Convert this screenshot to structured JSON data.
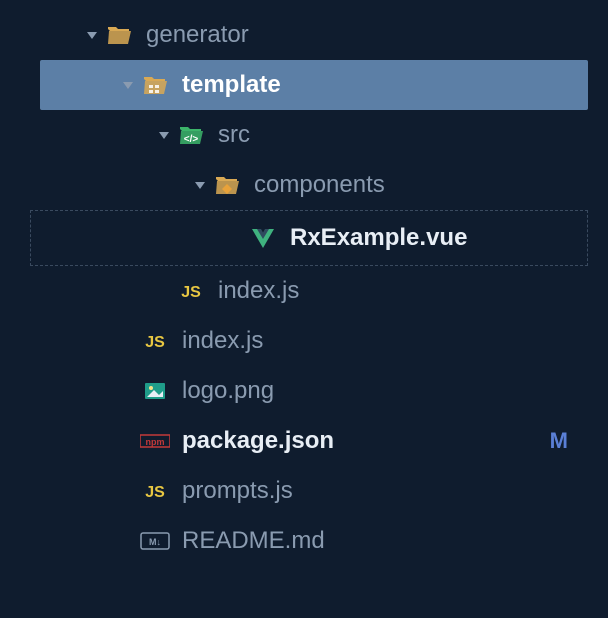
{
  "tree": {
    "items": [
      {
        "label": "generator",
        "icon": "folder-open",
        "depth": 0,
        "expanded": true,
        "selected": false,
        "dashed": false,
        "bold": false,
        "white": false
      },
      {
        "label": "template",
        "icon": "folder-template",
        "depth": 1,
        "expanded": true,
        "selected": true,
        "dashed": false,
        "bold": true,
        "white": true
      },
      {
        "label": "src",
        "icon": "folder-src",
        "depth": 2,
        "expanded": true,
        "selected": false,
        "dashed": false,
        "bold": false,
        "white": false
      },
      {
        "label": "components",
        "icon": "folder-comp",
        "depth": 3,
        "expanded": true,
        "selected": false,
        "dashed": false,
        "bold": false,
        "white": false
      },
      {
        "label": "RxExample.vue",
        "icon": "vue",
        "depth": 4,
        "expanded": null,
        "selected": false,
        "dashed": true,
        "bold": true,
        "white": true
      },
      {
        "label": "index.js",
        "icon": "js",
        "depth": 2,
        "expanded": null,
        "selected": false,
        "dashed": false,
        "bold": false,
        "white": false
      },
      {
        "label": "index.js",
        "icon": "js",
        "depth": 1,
        "expanded": null,
        "selected": false,
        "dashed": false,
        "bold": false,
        "white": false
      },
      {
        "label": "logo.png",
        "icon": "image",
        "depth": 1,
        "expanded": null,
        "selected": false,
        "dashed": false,
        "bold": false,
        "white": false
      },
      {
        "label": "package.json",
        "icon": "npm",
        "depth": 1,
        "expanded": null,
        "selected": false,
        "dashed": false,
        "bold": true,
        "white": true,
        "status": "M"
      },
      {
        "label": "prompts.js",
        "icon": "js",
        "depth": 1,
        "expanded": null,
        "selected": false,
        "dashed": false,
        "bold": false,
        "white": false
      },
      {
        "label": "README.md",
        "icon": "md",
        "depth": 1,
        "expanded": null,
        "selected": false,
        "dashed": false,
        "bold": false,
        "white": false
      }
    ]
  },
  "icons": {
    "folder-open": {
      "type": "folder",
      "color": "#d9a954"
    },
    "folder-template": {
      "type": "folder",
      "color": "#d9a954",
      "overlay": "grid"
    },
    "folder-src": {
      "type": "folder",
      "color": "#3cb56a",
      "overlay": "code"
    },
    "folder-comp": {
      "type": "folder",
      "color": "#d9a954",
      "overlay": "diamond"
    },
    "vue": {
      "type": "vue"
    },
    "js": {
      "type": "text",
      "text": "JS",
      "color": "#e8c742"
    },
    "image": {
      "type": "image"
    },
    "npm": {
      "type": "npm"
    },
    "md": {
      "type": "md"
    }
  },
  "layout": {
    "baseIndent": 80,
    "stepIndent": 36
  }
}
